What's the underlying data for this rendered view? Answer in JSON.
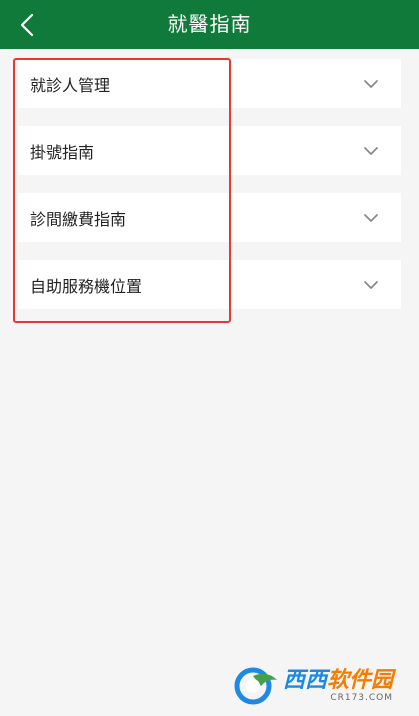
{
  "header": {
    "title": "就醫指南",
    "back_icon": "chevron-left-icon",
    "background_color": "#0f7a3a"
  },
  "items": [
    {
      "label": "就診人管理",
      "icon": "chevron-down-icon"
    },
    {
      "label": "掛號指南",
      "icon": "chevron-down-icon"
    },
    {
      "label": "診間繳費指南",
      "icon": "chevron-down-icon"
    },
    {
      "label": "自助服務機位置",
      "icon": "chevron-down-icon"
    }
  ],
  "highlight_color": "#e53935",
  "watermark": {
    "brand_part1": "西西",
    "brand_part2": "软件园",
    "domain": "CR173.COM"
  }
}
